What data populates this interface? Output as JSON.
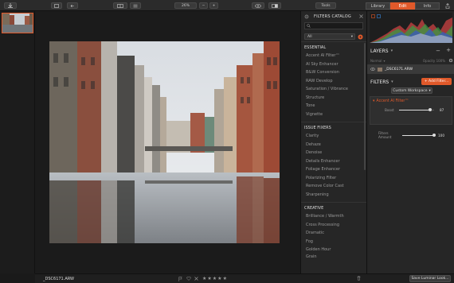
{
  "topbar": {
    "tools_label": "Tools",
    "zoom_label": "26%",
    "tabs": [
      {
        "label": "Library"
      },
      {
        "label": "Edit"
      },
      {
        "label": "Info"
      }
    ]
  },
  "catalog": {
    "title": "FILTERS CATALOG",
    "search_placeholder": "",
    "filter_dropdown": "All",
    "sections": [
      {
        "title": "ESSENTIAL",
        "items": [
          "Accent AI Filter™",
          "AI Sky Enhancer",
          "B&W Conversion",
          "RAW Develop",
          "Saturation / Vibrance",
          "Structure",
          "Tone",
          "Vignette"
        ]
      },
      {
        "title": "ISSUE FIXERS",
        "items": [
          "Clarity",
          "Dehaze",
          "Denoise",
          "Details Enhancer",
          "Foliage Enhancer",
          "Polarizing Filter",
          "Remove Color Cast",
          "Sharpening"
        ]
      },
      {
        "title": "CREATIVE",
        "items": [
          "Brilliance / Warmth",
          "Cross Processing",
          "Dramatic",
          "Fog",
          "Golden Hour",
          "Grain"
        ]
      }
    ]
  },
  "layers": {
    "title": "LAYERS",
    "mode": "Normal",
    "opacity_label": "Opacity 100%",
    "file_name": "_DSC6171.ARW"
  },
  "filters": {
    "title": "FILTERS",
    "add_label": "+ Add Filter...",
    "workspace_label": "Custom Workspace",
    "accent_title": "Accent AI Filter™",
    "boost_label": "Boost",
    "boost_value": "87",
    "amount_label": "Filters Amount",
    "amount_value": "100"
  },
  "bottom": {
    "file_name": "_DSC6171.ARW",
    "save_label": "Save Luminar Look..."
  },
  "colors": {
    "accent": "#e0592a",
    "panel": "#262626",
    "background": "#1a1a1a"
  }
}
